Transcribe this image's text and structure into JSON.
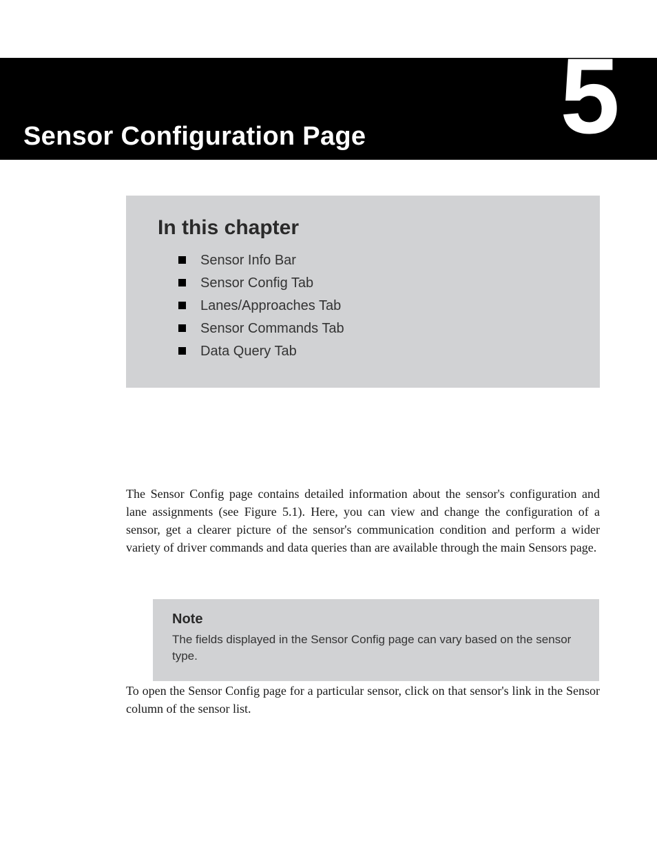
{
  "banner": {
    "title": "Sensor Configuration Page",
    "number": "5"
  },
  "chapter_box": {
    "heading": "In this chapter",
    "items": [
      "Sensor Info Bar",
      "Sensor Config Tab",
      "Lanes/Approaches Tab",
      "Sensor Commands Tab",
      "Data Query Tab"
    ]
  },
  "paragraphs": {
    "intro": "The Sensor Config page contains detailed information about the sensor's configuration and lane assignments (see Figure 5.1). Here, you can view and change the configuration of a sensor, get a clearer picture of the sensor's communication condition and perform a wider variety of driver commands and data queries than are available through the main Sensors page.",
    "open_instructions": "To open the Sensor Config page for a particular sensor, click on that sensor's link in the Sensor column of the sensor list."
  },
  "note": {
    "title": "Note",
    "body": "The fields displayed in the Sensor Config page can vary based on the sensor type."
  }
}
